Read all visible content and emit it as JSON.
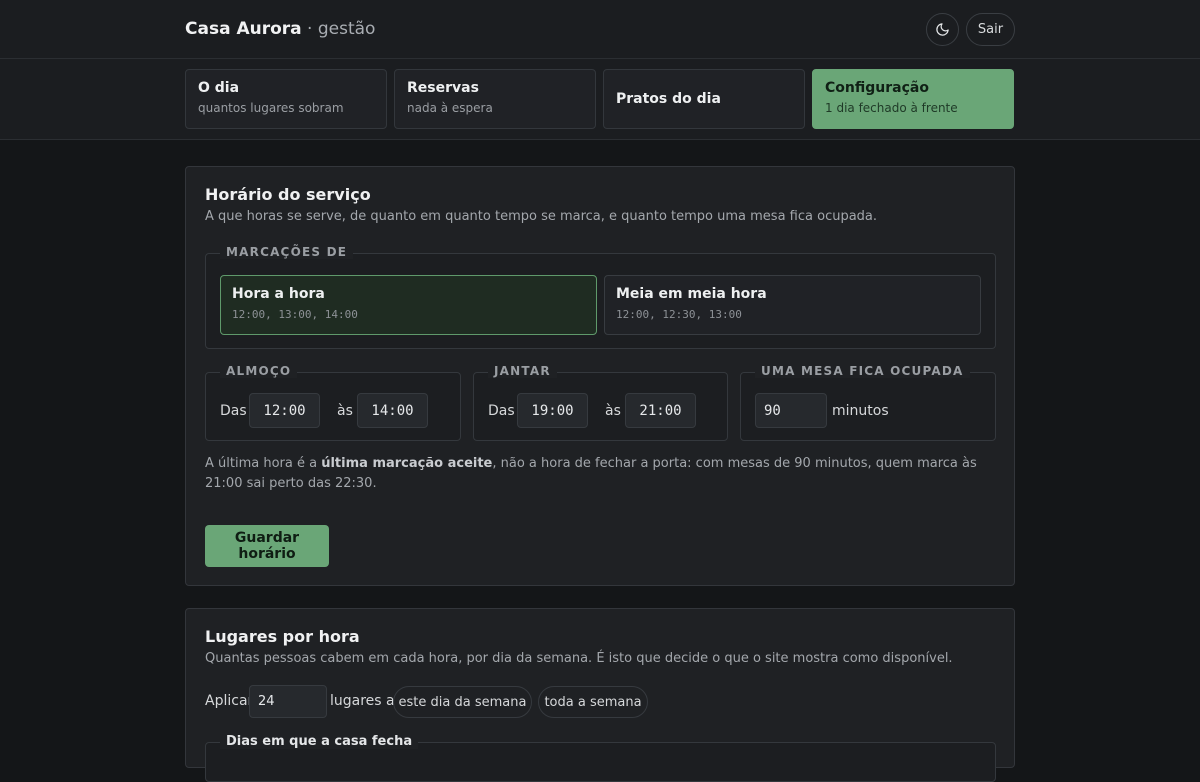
{
  "header": {
    "brand": "Casa Aurora",
    "brand_suffix": " · gestão",
    "theme_icon": "moon-icon",
    "logout_label": "Sair"
  },
  "nav": {
    "tabs": [
      {
        "title": "O dia",
        "subtitle": "quantos lugares sobram"
      },
      {
        "title": "Reservas",
        "subtitle": "nada à espera"
      },
      {
        "title": "Pratos do dia",
        "subtitle": ""
      },
      {
        "title": "Configuração",
        "subtitle": "1 dia fechado à frente",
        "active": true
      }
    ]
  },
  "schedule": {
    "title": "Horário do serviço",
    "description": "A que horas se serve, de quanto em quanto tempo se marca, e quanto tempo uma mesa fica ocupada.",
    "slots_legend": "MARCAÇÕES DE",
    "slot_options": [
      {
        "title": "Hora a hora",
        "example": "12:00, 13:00, 14:00",
        "selected": true
      },
      {
        "title": "Meia em meia hora",
        "example": "12:00, 12:30, 13:00",
        "selected": false
      }
    ],
    "lunch": {
      "legend": "ALMOÇO",
      "from_label": "Das",
      "from": "12:00",
      "to_label": "às",
      "to": "14:00"
    },
    "dinner": {
      "legend": "JANTAR",
      "from_label": "Das",
      "from": "19:00",
      "to_label": "às",
      "to": "21:00"
    },
    "occupancy": {
      "legend": "UMA MESA FICA OCUPADA",
      "value": "90",
      "unit": "minutos"
    },
    "note_prefix": "A última hora é a ",
    "note_bold": "última marcação aceite",
    "note_suffix": ", não a hora de fechar a porta: com mesas de 90 minutos, quem marca às 21:00 sai perto das 22:30.",
    "save_label": "Guardar horário"
  },
  "seats": {
    "title": "Lugares por hora",
    "description": "Quantas pessoas cabem em cada hora, por dia da semana. É isto que decide o que o site mostra como disponível.",
    "apply_label": "Aplicar",
    "apply_value": "24",
    "seats_to_label": "lugares a",
    "this_day_label": "este dia da semana",
    "whole_week_label": "toda a semana",
    "closed_days_legend": "Dias em que a casa fecha"
  },
  "colors": {
    "accent": "#6aa677",
    "background": "#141618",
    "card": "#1f2124"
  }
}
